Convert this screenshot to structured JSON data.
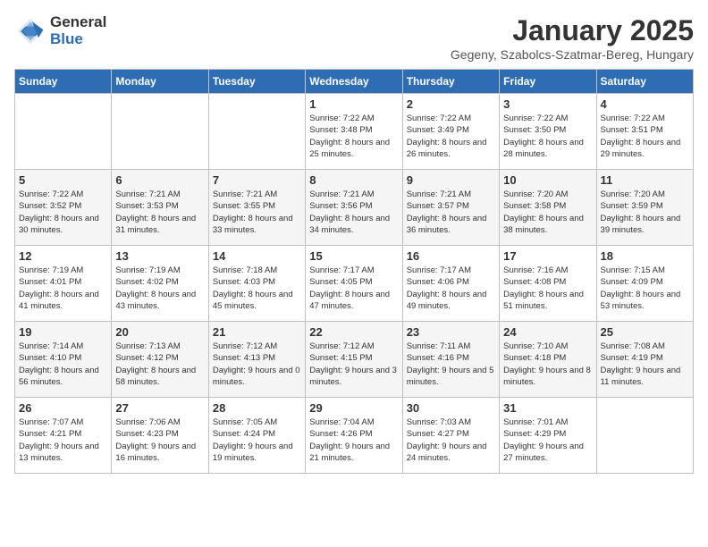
{
  "logo": {
    "general": "General",
    "blue": "Blue"
  },
  "title": "January 2025",
  "subtitle": "Gegeny, Szabolcs-Szatmar-Bereg, Hungary",
  "days_of_week": [
    "Sunday",
    "Monday",
    "Tuesday",
    "Wednesday",
    "Thursday",
    "Friday",
    "Saturday"
  ],
  "weeks": [
    [
      {
        "day": "",
        "info": ""
      },
      {
        "day": "",
        "info": ""
      },
      {
        "day": "",
        "info": ""
      },
      {
        "day": "1",
        "info": "Sunrise: 7:22 AM\nSunset: 3:48 PM\nDaylight: 8 hours and 25 minutes."
      },
      {
        "day": "2",
        "info": "Sunrise: 7:22 AM\nSunset: 3:49 PM\nDaylight: 8 hours and 26 minutes."
      },
      {
        "day": "3",
        "info": "Sunrise: 7:22 AM\nSunset: 3:50 PM\nDaylight: 8 hours and 28 minutes."
      },
      {
        "day": "4",
        "info": "Sunrise: 7:22 AM\nSunset: 3:51 PM\nDaylight: 8 hours and 29 minutes."
      }
    ],
    [
      {
        "day": "5",
        "info": "Sunrise: 7:22 AM\nSunset: 3:52 PM\nDaylight: 8 hours and 30 minutes."
      },
      {
        "day": "6",
        "info": "Sunrise: 7:21 AM\nSunset: 3:53 PM\nDaylight: 8 hours and 31 minutes."
      },
      {
        "day": "7",
        "info": "Sunrise: 7:21 AM\nSunset: 3:55 PM\nDaylight: 8 hours and 33 minutes."
      },
      {
        "day": "8",
        "info": "Sunrise: 7:21 AM\nSunset: 3:56 PM\nDaylight: 8 hours and 34 minutes."
      },
      {
        "day": "9",
        "info": "Sunrise: 7:21 AM\nSunset: 3:57 PM\nDaylight: 8 hours and 36 minutes."
      },
      {
        "day": "10",
        "info": "Sunrise: 7:20 AM\nSunset: 3:58 PM\nDaylight: 8 hours and 38 minutes."
      },
      {
        "day": "11",
        "info": "Sunrise: 7:20 AM\nSunset: 3:59 PM\nDaylight: 8 hours and 39 minutes."
      }
    ],
    [
      {
        "day": "12",
        "info": "Sunrise: 7:19 AM\nSunset: 4:01 PM\nDaylight: 8 hours and 41 minutes."
      },
      {
        "day": "13",
        "info": "Sunrise: 7:19 AM\nSunset: 4:02 PM\nDaylight: 8 hours and 43 minutes."
      },
      {
        "day": "14",
        "info": "Sunrise: 7:18 AM\nSunset: 4:03 PM\nDaylight: 8 hours and 45 minutes."
      },
      {
        "day": "15",
        "info": "Sunrise: 7:17 AM\nSunset: 4:05 PM\nDaylight: 8 hours and 47 minutes."
      },
      {
        "day": "16",
        "info": "Sunrise: 7:17 AM\nSunset: 4:06 PM\nDaylight: 8 hours and 49 minutes."
      },
      {
        "day": "17",
        "info": "Sunrise: 7:16 AM\nSunset: 4:08 PM\nDaylight: 8 hours and 51 minutes."
      },
      {
        "day": "18",
        "info": "Sunrise: 7:15 AM\nSunset: 4:09 PM\nDaylight: 8 hours and 53 minutes."
      }
    ],
    [
      {
        "day": "19",
        "info": "Sunrise: 7:14 AM\nSunset: 4:10 PM\nDaylight: 8 hours and 56 minutes."
      },
      {
        "day": "20",
        "info": "Sunrise: 7:13 AM\nSunset: 4:12 PM\nDaylight: 8 hours and 58 minutes."
      },
      {
        "day": "21",
        "info": "Sunrise: 7:12 AM\nSunset: 4:13 PM\nDaylight: 9 hours and 0 minutes."
      },
      {
        "day": "22",
        "info": "Sunrise: 7:12 AM\nSunset: 4:15 PM\nDaylight: 9 hours and 3 minutes."
      },
      {
        "day": "23",
        "info": "Sunrise: 7:11 AM\nSunset: 4:16 PM\nDaylight: 9 hours and 5 minutes."
      },
      {
        "day": "24",
        "info": "Sunrise: 7:10 AM\nSunset: 4:18 PM\nDaylight: 9 hours and 8 minutes."
      },
      {
        "day": "25",
        "info": "Sunrise: 7:08 AM\nSunset: 4:19 PM\nDaylight: 9 hours and 11 minutes."
      }
    ],
    [
      {
        "day": "26",
        "info": "Sunrise: 7:07 AM\nSunset: 4:21 PM\nDaylight: 9 hours and 13 minutes."
      },
      {
        "day": "27",
        "info": "Sunrise: 7:06 AM\nSunset: 4:23 PM\nDaylight: 9 hours and 16 minutes."
      },
      {
        "day": "28",
        "info": "Sunrise: 7:05 AM\nSunset: 4:24 PM\nDaylight: 9 hours and 19 minutes."
      },
      {
        "day": "29",
        "info": "Sunrise: 7:04 AM\nSunset: 4:26 PM\nDaylight: 9 hours and 21 minutes."
      },
      {
        "day": "30",
        "info": "Sunrise: 7:03 AM\nSunset: 4:27 PM\nDaylight: 9 hours and 24 minutes."
      },
      {
        "day": "31",
        "info": "Sunrise: 7:01 AM\nSunset: 4:29 PM\nDaylight: 9 hours and 27 minutes."
      },
      {
        "day": "",
        "info": ""
      }
    ]
  ]
}
